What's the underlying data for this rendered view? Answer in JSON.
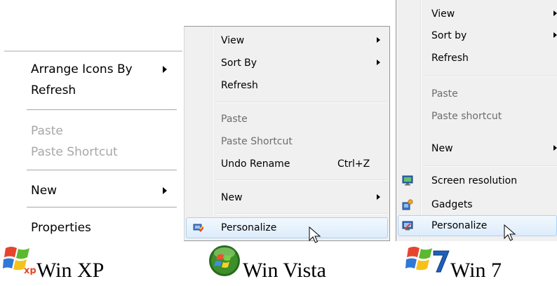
{
  "xp": {
    "items": [
      {
        "label": "Arrange Icons By",
        "submenu": true,
        "disabled": false
      },
      {
        "label": "Refresh",
        "submenu": false,
        "disabled": false
      },
      {
        "label": "Paste",
        "submenu": false,
        "disabled": true
      },
      {
        "label": "Paste Shortcut",
        "submenu": false,
        "disabled": true
      },
      {
        "label": "New",
        "submenu": true,
        "disabled": false
      },
      {
        "label": "Properties",
        "submenu": false,
        "disabled": false
      }
    ],
    "caption": "Win XP",
    "logo_icon": "windows-xp-logo-icon"
  },
  "vista": {
    "items": [
      {
        "label": "View",
        "submenu": true,
        "disabled": false
      },
      {
        "label": "Sort By",
        "submenu": true,
        "disabled": false
      },
      {
        "label": "Refresh",
        "submenu": false,
        "disabled": false
      },
      {
        "label": "Paste",
        "submenu": false,
        "disabled": true
      },
      {
        "label": "Paste Shortcut",
        "submenu": false,
        "disabled": true
      },
      {
        "label": "Undo Rename",
        "shortcut": "Ctrl+Z",
        "submenu": false,
        "disabled": false
      },
      {
        "label": "New",
        "submenu": true,
        "disabled": false
      },
      {
        "label": "Personalize",
        "submenu": false,
        "disabled": false,
        "icon": "personalize-icon",
        "hovered": true
      }
    ],
    "caption": "Win Vista",
    "logo_icon": "windows-vista-orb-icon"
  },
  "win7": {
    "items": [
      {
        "label": "View",
        "submenu": true,
        "disabled": false
      },
      {
        "label": "Sort by",
        "submenu": true,
        "disabled": false
      },
      {
        "label": "Refresh",
        "submenu": false,
        "disabled": false
      },
      {
        "label": "Paste",
        "submenu": false,
        "disabled": true
      },
      {
        "label": "Paste shortcut",
        "submenu": false,
        "disabled": true
      },
      {
        "label": "New",
        "submenu": true,
        "disabled": false
      },
      {
        "label": "Screen resolution",
        "submenu": false,
        "disabled": false,
        "icon": "screen-resolution-icon"
      },
      {
        "label": "Gadgets",
        "submenu": false,
        "disabled": false,
        "icon": "gadgets-icon"
      },
      {
        "label": "Personalize",
        "submenu": false,
        "disabled": false,
        "icon": "personalize-icon",
        "hovered": true
      }
    ],
    "caption": "Win 7",
    "logo_icon": "windows-7-logo-icon"
  },
  "colors": {
    "disabled_xp": "#a7a6aa",
    "disabled_vista": "#6d6d6d",
    "menu_background": "#f0f0f0",
    "hover_highlight": "#dcecfc",
    "hover_border": "#aed2f4"
  }
}
